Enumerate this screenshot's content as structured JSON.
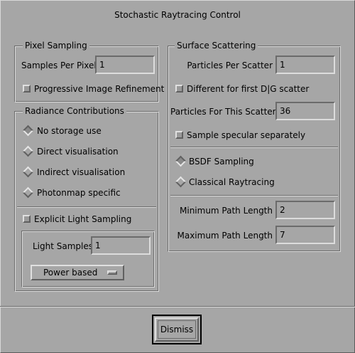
{
  "window": {
    "title": "Stochastic Raytracing Control"
  },
  "pixel_sampling": {
    "legend": "Pixel Sampling",
    "samples_label": "Samples Per Pixel",
    "samples_value": "1",
    "progressive_label": "Progressive Image Refinement"
  },
  "radiance": {
    "legend": "Radiance Contributions",
    "options": [
      {
        "label": "No storage use",
        "selected": true
      },
      {
        "label": "Direct visualisation",
        "selected": false
      },
      {
        "label": "Indirect visualisation",
        "selected": false
      },
      {
        "label": "Photonmap specific",
        "selected": false
      }
    ],
    "explicit_label": "Explicit Light Sampling",
    "light_samples_label": "Light Samples",
    "light_samples_value": "1",
    "power_option": "Power based"
  },
  "surface": {
    "legend": "Surface Scattering",
    "particles_per_scatter_label": "Particles Per Scatter",
    "particles_per_scatter_value": "1",
    "different_first_label": "Different for first D|G scatter",
    "particles_this_label": "Particles For This Scatter",
    "particles_this_value": "36",
    "sample_specular_label": "Sample specular separately",
    "methods": [
      {
        "label": "BSDF Sampling",
        "selected": true
      },
      {
        "label": "Classical Raytracing",
        "selected": false
      }
    ],
    "min_path_label": "Minimum Path Length",
    "min_path_value": "2",
    "max_path_label": "Maximum Path Length",
    "max_path_value": "7"
  },
  "dismiss_label": "Dismiss"
}
